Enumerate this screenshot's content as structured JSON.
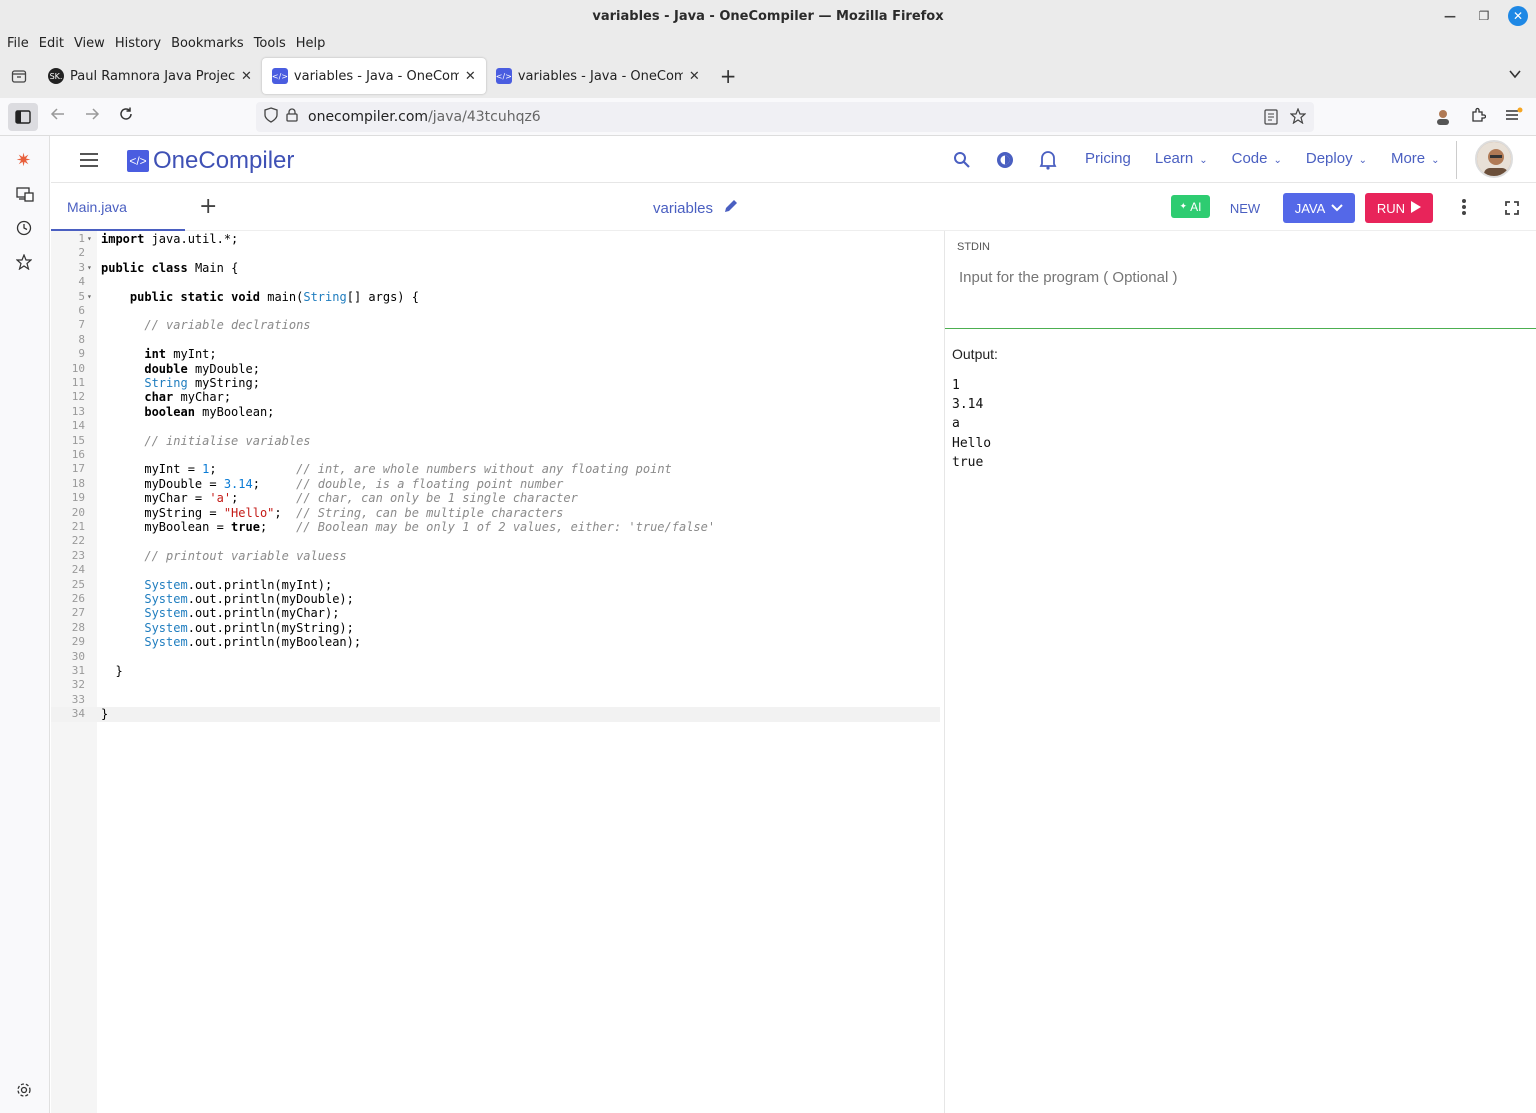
{
  "window": {
    "title": "variables - Java - OneCompiler — Mozilla Firefox"
  },
  "menu": [
    "File",
    "Edit",
    "View",
    "History",
    "Bookmarks",
    "Tools",
    "Help"
  ],
  "tabs": [
    {
      "title": "Paul Ramnora Java Project |",
      "favicon": "SK."
    },
    {
      "title": "variables - Java - OneCompi",
      "favicon": "</>"
    },
    {
      "title": "variables - Java - OneCompi",
      "favicon": "</>"
    }
  ],
  "url": {
    "domain": "onecompiler.com",
    "path": "/java/43tcuhqz6"
  },
  "app": {
    "logo": "OneCompiler",
    "logo_mark": "</>",
    "nav": [
      "Pricing",
      "Learn",
      "Code",
      "Deploy",
      "More"
    ]
  },
  "toolbar": {
    "file_tab": "Main.java",
    "project_name": "variables",
    "ai_label": "AI",
    "new_label": "NEW",
    "lang_label": "JAVA",
    "run_label": "RUN"
  },
  "colors": {
    "brand": "#4a5fc1",
    "ai_green": "#2ecc71",
    "lang_blue": "#5468e8",
    "run_pink": "#e8245a"
  },
  "editor": {
    "active_line": 34,
    "lines": [
      "import java.util.*;",
      "",
      "public class Main {",
      "",
      "    public static void main(String[] args) {",
      "",
      "      // variable declrations",
      "",
      "      int myInt;",
      "      double myDouble;",
      "      String myString;",
      "      char myChar;",
      "      boolean myBoolean;",
      "",
      "      // initialise variables",
      "",
      "      myInt = 1;           // int, are whole numbers without any floating point",
      "      myDouble = 3.14;     // double, is a floating point number",
      "      myChar = 'a';        // char, can only be 1 single character",
      "      myString = \"Hello\";  // String, can be multiple characters",
      "      myBoolean = true;    // Boolean may be only 1 of 2 values, either: 'true/false'",
      "",
      "      // printout variable valuess",
      "",
      "      System.out.println(myInt);",
      "      System.out.println(myDouble);",
      "      System.out.println(myChar);",
      "      System.out.println(myString);",
      "      System.out.println(myBoolean);",
      "",
      "  }",
      "",
      "",
      "}"
    ]
  },
  "stdin": {
    "label": "STDIN",
    "placeholder": "Input for the program ( Optional )"
  },
  "output": {
    "label": "Output:",
    "lines": [
      "1",
      "3.14",
      "a",
      "Hello",
      "true"
    ]
  }
}
